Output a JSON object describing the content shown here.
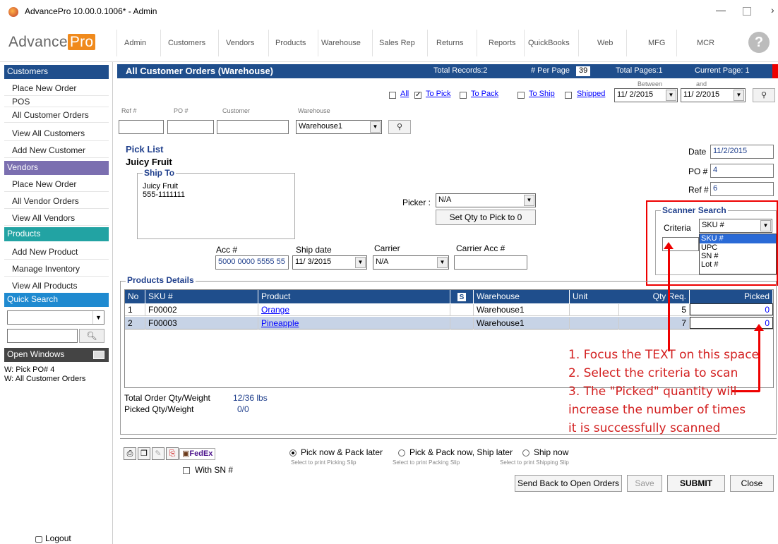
{
  "window": {
    "title": "AdvancePro 10.00.0.1006* - Admin"
  },
  "logo": {
    "part1": "Advance",
    "part2": "Pro"
  },
  "nav": {
    "items": [
      "Admin",
      "Customers",
      "Vendors",
      "Products",
      "Warehouse",
      "Sales Rep",
      "Returns",
      "Reports",
      "QuickBooks",
      "Web",
      "MFG",
      "MCR"
    ],
    "help": "?"
  },
  "sidebar": {
    "customers_head": "Customers",
    "customers": [
      "Place New Order",
      "POS",
      "All Customer Orders",
      "View All Customers",
      "Add New Customer"
    ],
    "vendors_head": "Vendors",
    "vendors": [
      "Place New Order",
      "All Vendor Orders",
      "View All Vendors"
    ],
    "products_head": "Products",
    "products": [
      "Add New Product",
      "Manage Inventory",
      "View All Products"
    ],
    "quick_search_head": "Quick Search",
    "open_windows_head": "Open Windows",
    "open_windows": [
      "W: Pick PO# 4",
      "W: All Customer Orders"
    ],
    "logout": "Logout",
    "colors": {
      "customers": "#1f4e8c",
      "vendors": "#7b6fb0",
      "products": "#22a3a3",
      "quick": "#1f8ad0"
    }
  },
  "header": {
    "title": "All Customer Orders (Warehouse)",
    "total_records": "Total Records:2",
    "per_page_label": "# Per Page",
    "per_page": "39",
    "total_pages": "Total Pages:1",
    "current_page": "Current Page:  1"
  },
  "filters": {
    "all": "All",
    "to_pick": "To Pick",
    "to_pack": "To Pack",
    "to_ship": "To Ship",
    "shipped": "Shipped",
    "between": "Between",
    "and": "and",
    "date_from": "11/  2/2015",
    "date_to": "11/  2/2015",
    "ref_label": "Ref #",
    "po_label": "PO #",
    "customer_label": "Customer",
    "warehouse_label": "Warehouse",
    "warehouse": "Warehouse1"
  },
  "pick": {
    "title": "Pick List",
    "customer": "Juicy Fruit",
    "ship_to_legend": "Ship To",
    "ship_to_name": "Juicy Fruit",
    "ship_to_phone": "555-1111111",
    "date_label": "Date",
    "date": "11/2/2015",
    "po_label": "PO #",
    "po": "4",
    "ref_label": "Ref #",
    "ref": "6",
    "picker_label": "Picker :",
    "picker": "N/A",
    "set_qty_button": "Set Qty to Pick to 0",
    "acc_label": "Acc #",
    "acc": "5000 0000 5555 55",
    "ship_date_label": "Ship date",
    "ship_date": "11/  3/2015",
    "carrier_label": "Carrier",
    "carrier": "N/A",
    "carrier_acc_label": "Carrier Acc #"
  },
  "scanner": {
    "legend": "Scanner Search",
    "criteria_label": "Criteria",
    "criteria": "SKU #",
    "options": [
      "SKU #",
      "UPC",
      "SN #",
      "Lot #"
    ]
  },
  "products": {
    "legend": "Products Details",
    "columns": [
      "No",
      "SKU #",
      "Product",
      "S",
      "Warehouse",
      "Unit",
      "Qty Req.",
      "Picked"
    ],
    "rows": [
      {
        "no": "1",
        "sku": "F00002",
        "product": "Orange",
        "warehouse": "Warehouse1",
        "unit": "",
        "qty": "5",
        "picked": "0"
      },
      {
        "no": "2",
        "sku": "F00003",
        "product": "Pineapple",
        "warehouse": "Warehouse1",
        "unit": "",
        "qty": "7",
        "picked": "0"
      }
    ]
  },
  "totals": {
    "order_label": "Total Order Qty/Weight",
    "order": "12/36 lbs",
    "picked_label": "Picked Qty/Weight",
    "picked": "0/0"
  },
  "options": {
    "with_sn": "With SN #",
    "pick_now": "Pick now & Pack later",
    "pick_now_sub": "Select to print Picking Slip",
    "pick_pack": "Pick & Pack now, Ship later",
    "pick_pack_sub": "Select to print Packing Slip",
    "ship_now": "Ship now",
    "ship_now_sub": "Select to print Shipping Slip",
    "fedex": "FedEx"
  },
  "buttons": {
    "send_back": "Send Back to Open Orders",
    "save": "Save",
    "submit": "SUBMIT",
    "close": "Close"
  },
  "annotation": {
    "line1": "1. Focus the TEXT on this space",
    "line2": "2. Select the criteria to scan",
    "line3": "3. The \"Picked\" quantity will",
    "line4": "increase the number of times",
    "line5": "it is successfully scanned"
  }
}
